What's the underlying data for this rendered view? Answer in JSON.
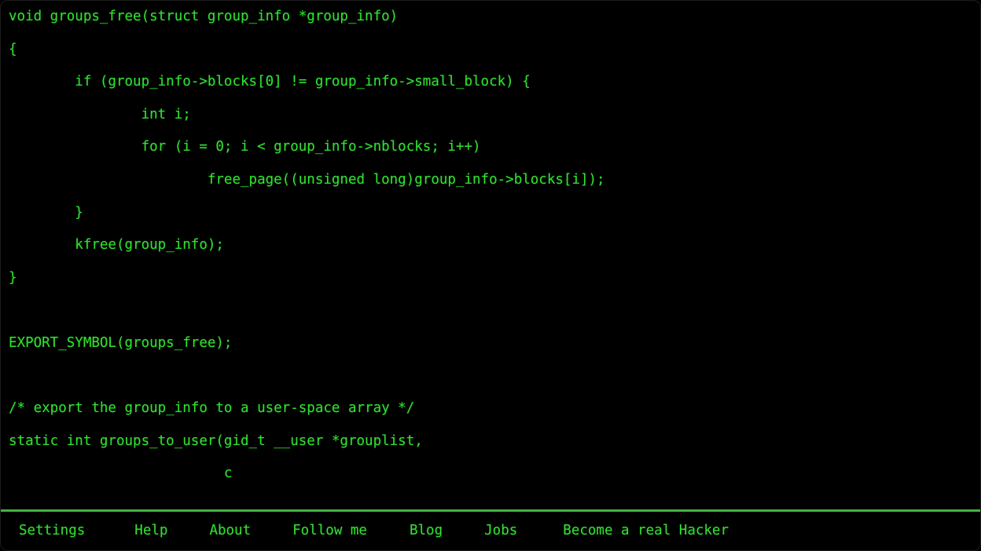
{
  "theme": {
    "background": "#000000",
    "text_green": "#2fe02f",
    "rule_green": "#43b143",
    "border": "#1c1c1c"
  },
  "code": {
    "language": "c",
    "lines": [
      "void groups_free(struct group_info *group_info)",
      "{",
      "        if (group_info->blocks[0] != group_info->small_block) {",
      "                int i;",
      "                for (i = 0; i < group_info->nblocks; i++)",
      "                        free_page((unsigned long)group_info->blocks[i]);",
      "        }",
      "        kfree(group_info);",
      "}",
      "",
      "EXPORT_SYMBOL(groups_free);",
      "",
      "/* export the group_info to a user-space array */",
      "static int groups_to_user(gid_t __user *grouplist,",
      "                          c"
    ]
  },
  "footer": {
    "items": [
      {
        "label": "Settings",
        "name": "nav-settings"
      },
      {
        "label": "Help",
        "name": "nav-help"
      },
      {
        "label": "About",
        "name": "nav-about"
      },
      {
        "label": "Follow me",
        "name": "nav-follow-me"
      },
      {
        "label": "Blog",
        "name": "nav-blog"
      },
      {
        "label": "Jobs",
        "name": "nav-jobs"
      },
      {
        "label": "Become a real Hacker",
        "name": "nav-become-a-real-hacker"
      }
    ]
  }
}
